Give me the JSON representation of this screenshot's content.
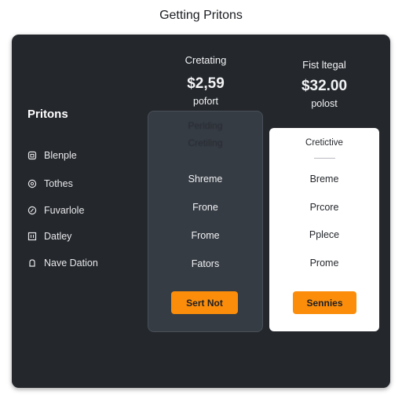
{
  "page": {
    "title": "Getting Pritons"
  },
  "sidebar": {
    "title": "Pritons",
    "items": [
      {
        "label": "Blenple",
        "icon": "lock-icon"
      },
      {
        "label": "Tothes",
        "icon": "circle-icon"
      },
      {
        "label": "Fuvarlole",
        "icon": "leaf-icon"
      },
      {
        "label": "Datley",
        "icon": "grid-icon"
      },
      {
        "label": "Nave Dation",
        "icon": "bell-icon"
      }
    ]
  },
  "plans": [
    {
      "name": "Cretating",
      "price": "$2,59",
      "period": "pofort",
      "ghost": [
        "Perlding",
        "Cretiling"
      ],
      "features": [
        "Shreme",
        "Frone",
        "Frome",
        "Fators"
      ],
      "button": "Sert Not"
    },
    {
      "name": "Fist ltegal",
      "price": "$32.00",
      "period": "polost",
      "subtitle": "Cretictive",
      "features": [
        "Breme",
        "Prcore",
        "Pplece",
        "Prome"
      ],
      "button": "Sennies"
    }
  ],
  "colors": {
    "panel": "#24272c",
    "basic_column": "#363c44",
    "accent": "#fb8d0b"
  }
}
